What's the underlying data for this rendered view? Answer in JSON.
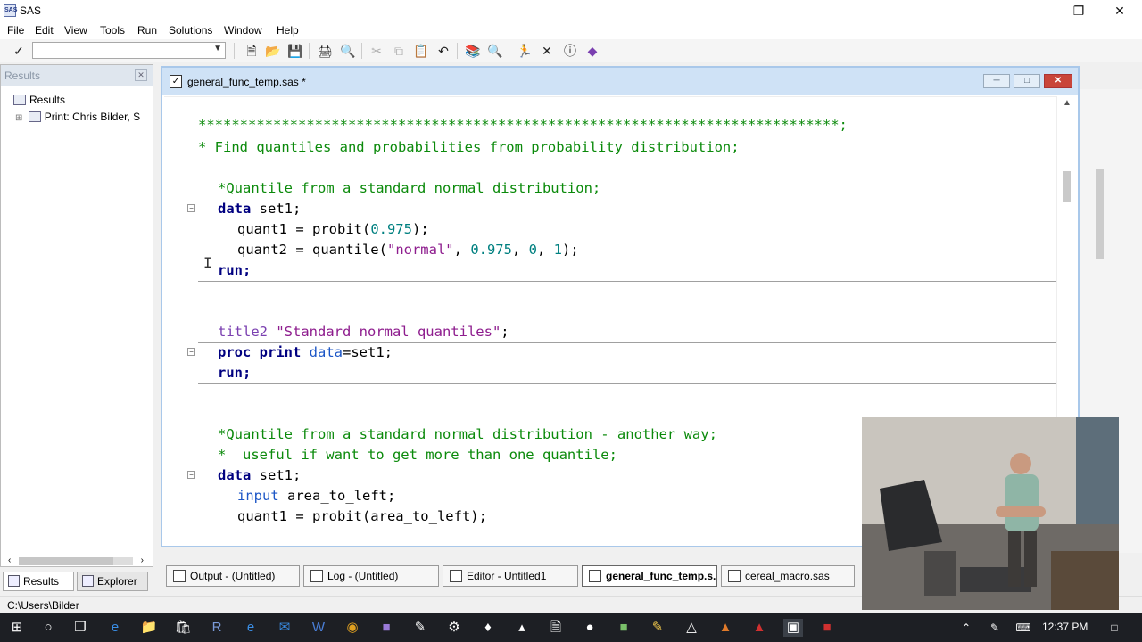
{
  "window": {
    "title": "SAS"
  },
  "menu": [
    "File",
    "Edit",
    "View",
    "Tools",
    "Run",
    "Solutions",
    "Window",
    "Help"
  ],
  "toolbar": {
    "command_value": "",
    "buttons": [
      "check-icon",
      "new-icon",
      "open-icon",
      "save-icon",
      "print-icon",
      "print-preview-icon",
      "cut-icon",
      "copy-icon",
      "paste-icon",
      "undo-icon",
      "library-icon",
      "explorer-icon",
      "run-icon",
      "clear-icon",
      "break-icon",
      "help-icon"
    ]
  },
  "results": {
    "header": "Results",
    "tree": {
      "root": "Results",
      "child": "Print:  Chris Bilder, S"
    },
    "tabs": [
      "Results",
      "Explorer"
    ]
  },
  "editor": {
    "title": "general_func_temp.sas *",
    "lines": [
      {
        "l": "*****************************************************************************;"
      },
      {
        "l": "* Find quantiles and probabilities from probability distribution;"
      },
      {
        "l": "*Quantile from a standard normal distribution;"
      },
      {
        "kw": "data",
        "rest": " set1;"
      },
      {
        "a": "quant1 = probit(",
        "num": "0.975",
        "b": ");"
      },
      {
        "a": "quant2 = quantile(",
        "str": "\"normal\"",
        "b": ", ",
        "n1": "0.975",
        "c": ", ",
        "n2": "0",
        "d": ", ",
        "n3": "1",
        "e": ");"
      },
      {
        "kw": "run;"
      },
      {
        "fn": "title2",
        "str": " \"Standard normal quantiles\"",
        "rest": ";"
      },
      {
        "kw": "proc print",
        "opt": " data",
        "rest": "=set1;"
      },
      {
        "kw": "run;"
      },
      {
        "l": "*Quantile from a standard normal distribution - another way;"
      },
      {
        "l": "*  useful if want to get more than one quantile;"
      },
      {
        "kw": "data",
        "rest": " set1;"
      },
      {
        "fn": "input",
        "rest": " area_to_left;"
      },
      {
        "a": "quant1 = probit(area_to_left);"
      }
    ]
  },
  "window_tabs": [
    {
      "label": "Output - (Untitled)"
    },
    {
      "label": "Log - (Untitled)"
    },
    {
      "label": "Editor - Untitled1"
    },
    {
      "label": "general_func_temp.s..."
    },
    {
      "label": "cereal_macro.sas"
    }
  ],
  "status": {
    "path": "C:\\Users\\Bilder"
  },
  "taskbar": {
    "time": "12:37 PM"
  }
}
